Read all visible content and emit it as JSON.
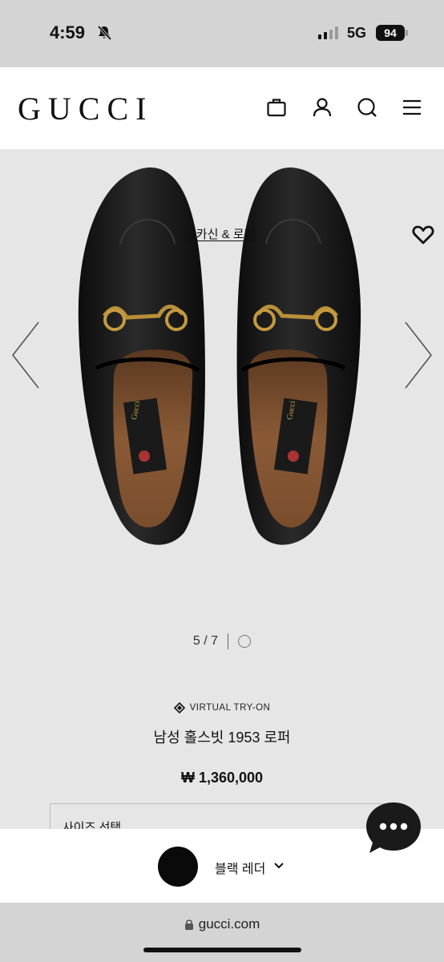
{
  "status_bar": {
    "time": "4:59",
    "network": "5G",
    "battery": "94"
  },
  "header": {
    "logo": "GUCCI"
  },
  "breadcrumb": "모카신 & 로퍼",
  "gallery": {
    "current": "5",
    "separator": "/",
    "total": "7"
  },
  "virtual_try_on": "VIRTUAL TRY-ON",
  "product": {
    "name": "남성 홀스빗 1953 로퍼",
    "price": "₩ 1,360,000"
  },
  "size_select": {
    "label": "사이즈 선택"
  },
  "variant": {
    "color_label": "블랙 레더",
    "swatch_color": "#0a0a0a"
  },
  "browser": {
    "url": "gucci.com"
  },
  "colors": {
    "background": "#e6e6e6",
    "header": "#ffffff",
    "chat_bubble": "#1a1a1a"
  },
  "icons": [
    "bell-slash-icon",
    "bag-icon",
    "user-icon",
    "search-icon",
    "menu-icon",
    "heart-icon",
    "chevron-left-icon",
    "chevron-right-icon",
    "virtual-try-on-icon",
    "chat-icon",
    "chevron-down-icon",
    "lock-icon"
  ]
}
